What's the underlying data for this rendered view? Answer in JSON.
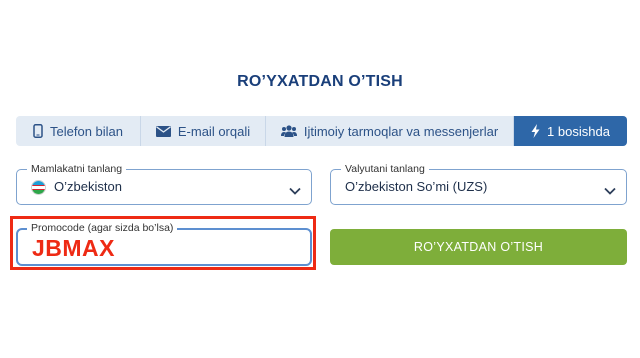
{
  "form": {
    "title": "RO’YXATDAN O’TISH",
    "tabs": [
      {
        "label": "Telefon bilan",
        "icon": "phone-icon"
      },
      {
        "label": "E-mail orqali",
        "icon": "envelope-icon"
      },
      {
        "label": "Ijtimoiy tarmoqlar va messenjerlar",
        "icon": "users-icon"
      },
      {
        "label": "1 bosishda",
        "icon": "lightning-icon",
        "active": true
      }
    ],
    "country": {
      "label": "Mamlakatni tanlang",
      "value": "O’zbekiston",
      "flag": "uzbekistan-flag-icon"
    },
    "currency": {
      "label": "Valyutani tanlang",
      "value": "O’zbekiston So’mi (UZS)"
    },
    "promo": {
      "label": "Promocode (agar sizda bo’lsa)",
      "value": "JBMAX"
    },
    "submit_label": "RO’YXATDAN O’TISH"
  },
  "colors": {
    "title": "#1a3f7a",
    "tab_bg": "#e3ebf4",
    "tab_active": "#2e67a8",
    "button": "#7eae3a",
    "highlight": "#ee2a14",
    "field_border": "#7fa3cf"
  }
}
